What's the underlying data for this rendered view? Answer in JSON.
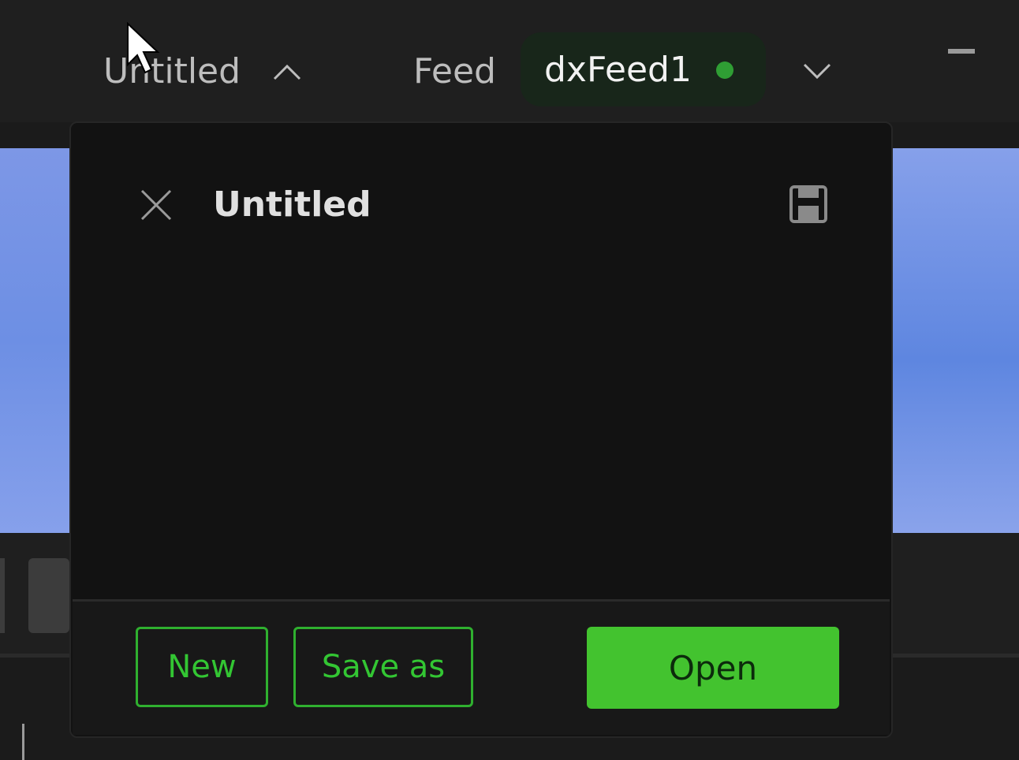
{
  "header": {
    "workspace_title": "Untitled",
    "feed_label": "Feed",
    "feed_name": "dxFeed1",
    "feed_status_color": "#2f9e34",
    "icons": [
      "chevron-up-icon",
      "chevron-down-icon",
      "minimize-icon"
    ]
  },
  "popup": {
    "title": "Untitled",
    "icons": [
      "close-icon",
      "save-icon"
    ],
    "buttons": {
      "new_label": "New",
      "save_as_label": "Save as",
      "open_label": "Open"
    }
  },
  "colors": {
    "accent": "#43c32f",
    "background": "#121212"
  }
}
